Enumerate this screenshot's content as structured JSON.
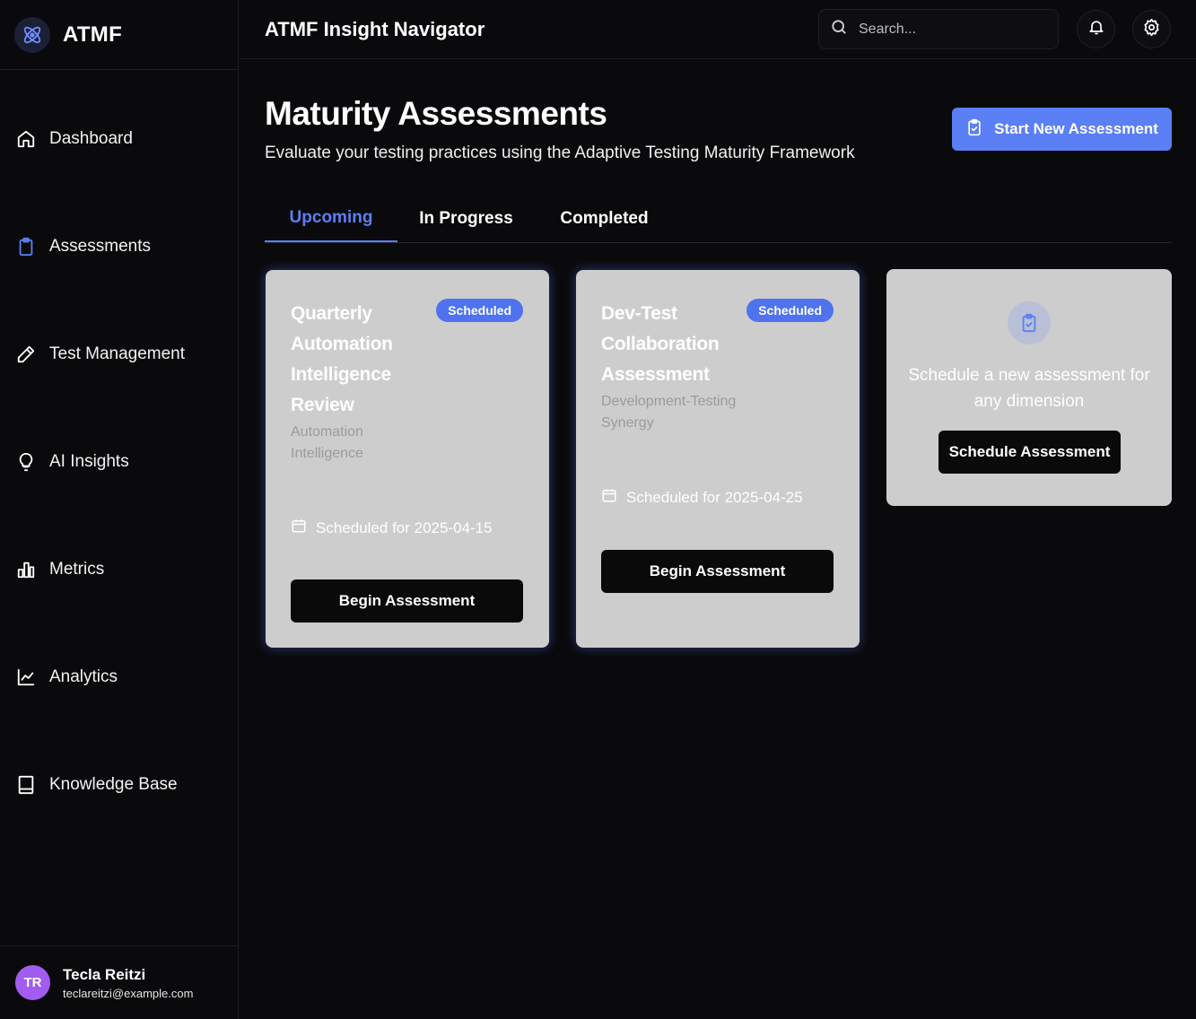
{
  "brand": {
    "name": "ATMF",
    "logo_icon": "atom-icon"
  },
  "sidebar": {
    "items": [
      {
        "label": "Dashboard",
        "icon": "home-icon",
        "active": false
      },
      {
        "label": "Assessments",
        "icon": "clipboard-icon",
        "active": true
      },
      {
        "label": "Test Management",
        "icon": "pencil-ruler-icon",
        "active": false
      },
      {
        "label": "AI Insights",
        "icon": "lightbulb-icon",
        "active": false
      },
      {
        "label": "Metrics",
        "icon": "bar-chart-icon",
        "active": false
      },
      {
        "label": "Analytics",
        "icon": "line-chart-icon",
        "active": false
      },
      {
        "label": "Knowledge Base",
        "icon": "book-icon",
        "active": false
      }
    ]
  },
  "user": {
    "initials": "TR",
    "name": "Tecla Reitzi",
    "email": "teclareitzi@example.com"
  },
  "header": {
    "title": "ATMF Insight Navigator",
    "search_placeholder": "Search...",
    "notifications_icon": "bell-icon",
    "settings_icon": "gear-icon"
  },
  "page": {
    "title": "Maturity Assessments",
    "subtitle": "Evaluate your testing practices using the Adaptive Testing Maturity Framework",
    "primary_action": "Start New Assessment"
  },
  "tabs": [
    {
      "label": "Upcoming",
      "active": true
    },
    {
      "label": "In Progress",
      "active": false
    },
    {
      "label": "Completed",
      "active": false
    }
  ],
  "cards": [
    {
      "title": "Quarterly Automation Intelligence Review",
      "badge": "Scheduled",
      "dimension": "Automation Intelligence",
      "date_text": "Scheduled for 2025-04-15",
      "action": "Begin Assessment"
    },
    {
      "title": "Dev-Test Collaboration Assessment",
      "badge": "Scheduled",
      "dimension": "Development-Testing Synergy",
      "date_text": "Scheduled for 2025-04-25",
      "action": "Begin Assessment"
    }
  ],
  "schedule_card": {
    "text": "Schedule a new assessment for any dimension",
    "action": "Schedule Assessment"
  },
  "colors": {
    "accent": "#5b7ff5",
    "badge": "#4f73ee",
    "card_bg": "#cdcdcd",
    "avatar": "#a35cf0",
    "background": "#0a0a0c"
  }
}
